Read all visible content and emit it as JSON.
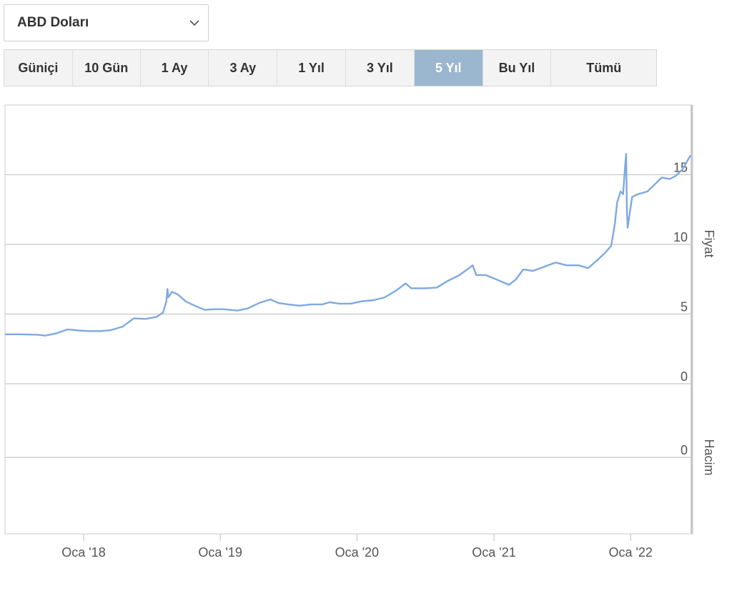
{
  "currency_selector": {
    "value": "ABD Doları"
  },
  "range_buttons": [
    {
      "label": "Güniçi",
      "active": false
    },
    {
      "label": "10 Gün",
      "active": false
    },
    {
      "label": "1 Ay",
      "active": false
    },
    {
      "label": "3 Ay",
      "active": false
    },
    {
      "label": "1 Yıl",
      "active": false
    },
    {
      "label": "3 Yıl",
      "active": false
    },
    {
      "label": "5 Yıl",
      "active": true
    },
    {
      "label": "Bu Yıl",
      "active": false
    },
    {
      "label": "Tümü",
      "active": false
    }
  ],
  "colors": {
    "line": "#7ea9e1",
    "grid": "#c8c8c8",
    "active_button": "#9ab7cf"
  },
  "chart_data": {
    "type": "line",
    "title": "",
    "price_axis": {
      "label": "Fiyat",
      "ticks": [
        0,
        5,
        10,
        15
      ],
      "range": [
        0,
        20
      ]
    },
    "volume_axis": {
      "label": "Hacim",
      "ticks": [
        0
      ]
    },
    "x_ticks": [
      {
        "label": "Oca '18",
        "date": "2018-01-01"
      },
      {
        "label": "Oca '19",
        "date": "2019-01-01"
      },
      {
        "label": "Oca '20",
        "date": "2020-01-01"
      },
      {
        "label": "Oca '21",
        "date": "2021-01-01"
      },
      {
        "label": "Oca '22",
        "date": "2022-01-01"
      }
    ],
    "x_range": [
      "2017-06-05",
      "2022-06-10"
    ],
    "series": [
      {
        "data": [
          [
            "2017-06-05",
            3.55
          ],
          [
            "2017-07-15",
            3.55
          ],
          [
            "2017-09-01",
            3.52
          ],
          [
            "2017-09-20",
            3.45
          ],
          [
            "2017-10-20",
            3.62
          ],
          [
            "2017-11-20",
            3.9
          ],
          [
            "2017-12-20",
            3.82
          ],
          [
            "2018-01-15",
            3.78
          ],
          [
            "2018-02-15",
            3.78
          ],
          [
            "2018-03-15",
            3.85
          ],
          [
            "2018-04-15",
            4.1
          ],
          [
            "2018-05-15",
            4.7
          ],
          [
            "2018-06-15",
            4.65
          ],
          [
            "2018-07-15",
            4.8
          ],
          [
            "2018-08-01",
            5.1
          ],
          [
            "2018-08-10",
            5.9
          ],
          [
            "2018-08-13",
            6.8
          ],
          [
            "2018-08-15",
            6.2
          ],
          [
            "2018-08-25",
            6.6
          ],
          [
            "2018-09-10",
            6.4
          ],
          [
            "2018-10-01",
            5.9
          ],
          [
            "2018-10-25",
            5.6
          ],
          [
            "2018-11-20",
            5.3
          ],
          [
            "2018-12-15",
            5.35
          ],
          [
            "2019-01-10",
            5.35
          ],
          [
            "2019-02-15",
            5.25
          ],
          [
            "2019-03-15",
            5.4
          ],
          [
            "2019-04-15",
            5.8
          ],
          [
            "2019-05-15",
            6.05
          ],
          [
            "2019-06-05",
            5.8
          ],
          [
            "2019-07-01",
            5.7
          ],
          [
            "2019-08-01",
            5.6
          ],
          [
            "2019-09-01",
            5.7
          ],
          [
            "2019-10-01",
            5.7
          ],
          [
            "2019-10-20",
            5.85
          ],
          [
            "2019-11-15",
            5.75
          ],
          [
            "2019-12-15",
            5.75
          ],
          [
            "2020-01-15",
            5.92
          ],
          [
            "2020-02-15",
            6.0
          ],
          [
            "2020-03-15",
            6.2
          ],
          [
            "2020-04-15",
            6.7
          ],
          [
            "2020-05-10",
            7.2
          ],
          [
            "2020-05-25",
            6.85
          ],
          [
            "2020-07-01",
            6.85
          ],
          [
            "2020-08-01",
            6.9
          ],
          [
            "2020-09-01",
            7.4
          ],
          [
            "2020-10-01",
            7.8
          ],
          [
            "2020-11-05",
            8.5
          ],
          [
            "2020-11-15",
            7.8
          ],
          [
            "2020-12-10",
            7.8
          ],
          [
            "2021-01-15",
            7.4
          ],
          [
            "2021-02-10",
            7.1
          ],
          [
            "2021-03-01",
            7.5
          ],
          [
            "2021-03-20",
            8.2
          ],
          [
            "2021-04-15",
            8.1
          ],
          [
            "2021-05-15",
            8.4
          ],
          [
            "2021-06-15",
            8.7
          ],
          [
            "2021-07-15",
            8.5
          ],
          [
            "2021-08-15",
            8.5
          ],
          [
            "2021-09-10",
            8.3
          ],
          [
            "2021-10-01",
            8.8
          ],
          [
            "2021-10-25",
            9.4
          ],
          [
            "2021-11-10",
            9.9
          ],
          [
            "2021-11-20",
            11.5
          ],
          [
            "2021-11-26",
            13.0
          ],
          [
            "2021-12-05",
            13.8
          ],
          [
            "2021-12-12",
            13.6
          ],
          [
            "2021-12-17",
            15.5
          ],
          [
            "2021-12-20",
            16.5
          ],
          [
            "2021-12-22",
            12.5
          ],
          [
            "2021-12-24",
            11.2
          ],
          [
            "2022-01-05",
            13.4
          ],
          [
            "2022-01-20",
            13.6
          ],
          [
            "2022-02-15",
            13.8
          ],
          [
            "2022-03-10",
            14.4
          ],
          [
            "2022-03-25",
            14.8
          ],
          [
            "2022-04-15",
            14.7
          ],
          [
            "2022-05-01",
            14.9
          ],
          [
            "2022-05-20",
            15.4
          ],
          [
            "2022-06-10",
            16.4
          ]
        ]
      }
    ]
  }
}
